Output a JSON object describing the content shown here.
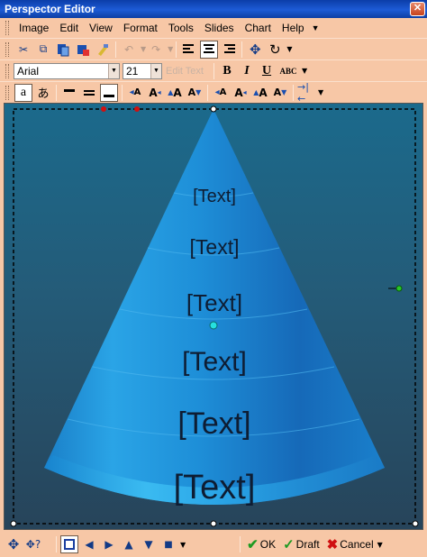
{
  "window": {
    "title": "Perspector Editor",
    "close_glyph": "✕"
  },
  "menu": {
    "items": [
      "Image",
      "Edit",
      "View",
      "Format",
      "Tools",
      "Slides",
      "Chart",
      "Help"
    ],
    "more_glyph": "▼"
  },
  "toolbar1": {
    "icons": [
      "cut-icon",
      "copy-icon",
      "paste-icon",
      "delete-icon",
      "format-painter-icon",
      "undo-icon",
      "redo-icon",
      "align-left-icon",
      "align-center-icon",
      "align-right-icon",
      "move-icon",
      "rotate-icon"
    ]
  },
  "toolbar2": {
    "font_name": "Arial",
    "font_size": "21",
    "edit_text_label": "Edit Text",
    "bold_label": "B",
    "italic_label": "I",
    "underline_label": "U",
    "abc_label": "ABC"
  },
  "toolbar3": {
    "hiragana_a": "a",
    "hiragana_jp": "あ"
  },
  "cone": {
    "labels": [
      "[Text]",
      "[Text]",
      "[Text]",
      "[Text]",
      "[Text]",
      "[Text]"
    ],
    "colors": {
      "light": "#39b4f0",
      "mid": "#1e8fd8",
      "dark": "#1256a3",
      "background": "#245b78"
    }
  },
  "bottom": {
    "ok_label": "OK",
    "draft_label": "Draft",
    "cancel_label": "Cancel"
  }
}
